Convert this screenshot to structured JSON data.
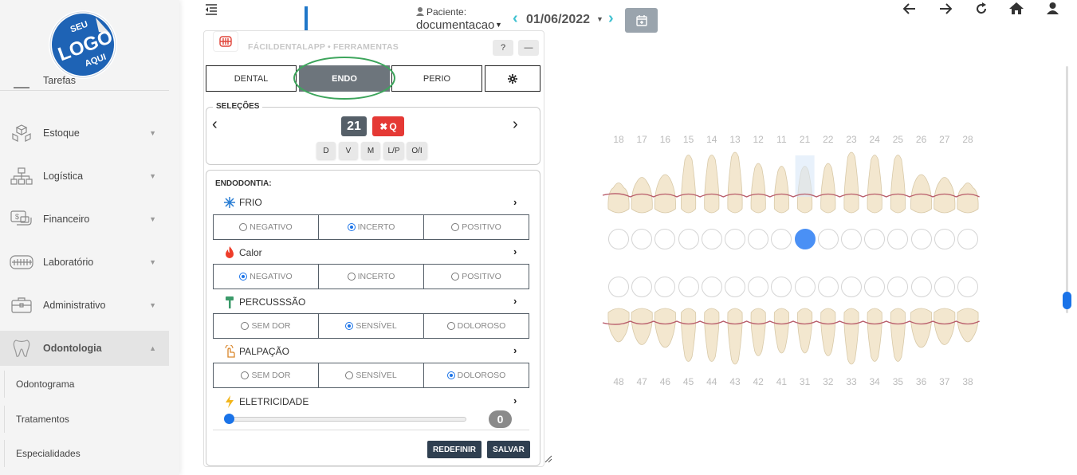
{
  "sidebar": {
    "logo": {
      "line1": "SEU",
      "line2": "LOGO",
      "line3": "AQUI"
    },
    "items": [
      {
        "label": "Tarefas",
        "icon": "tasks-icon"
      },
      {
        "label": "Estoque",
        "icon": "boxes-icon"
      },
      {
        "label": "Logística",
        "icon": "network-icon"
      },
      {
        "label": "Financeiro",
        "icon": "money-icon"
      },
      {
        "label": "Laboratório",
        "icon": "dental-lab-icon"
      },
      {
        "label": "Administrativo",
        "icon": "briefcase-icon"
      },
      {
        "label": "Odontologia",
        "icon": "tooth-icon"
      }
    ],
    "subitems": [
      "Odontograma",
      "Tratamentos",
      "Especialidades"
    ]
  },
  "topbar": {
    "patient_label": "Paciente:",
    "patient_name": "documentacao",
    "date": "01/06/2022"
  },
  "panel": {
    "title": "FÁCILDENTALAPP • FERRAMENTAS",
    "tabs": [
      "DENTAL",
      "ENDO",
      "PERIO"
    ],
    "active_tab": "ENDO",
    "selections": {
      "legend": "SELEÇÕES",
      "tooth": "21",
      "remove": "Q",
      "faces": [
        "D",
        "V",
        "M",
        "L/P",
        "O/I"
      ]
    },
    "endo": {
      "legend": "ENDODONTIA:",
      "rows": [
        {
          "label": "FRIO",
          "icon": "snowflake-icon",
          "options": [
            "NEGATIVO",
            "INCERTO",
            "POSITIVO"
          ],
          "selected": 1
        },
        {
          "label": "Calor",
          "icon": "fire-icon",
          "options": [
            "NEGATIVO",
            "INCERTO",
            "POSITIVO"
          ],
          "selected": 0
        },
        {
          "label": "PERCUSSSÃO",
          "icon": "hammer-icon",
          "options": [
            "SEM DOR",
            "SENSÍVEL",
            "DOLOROSO"
          ],
          "selected": 1
        },
        {
          "label": "PALPAÇÃO",
          "icon": "finger-icon",
          "options": [
            "SEM DOR",
            "SENSÍVEL",
            "DOLOROSO"
          ],
          "selected": 2
        }
      ],
      "electricity": {
        "label": "ELETRICIDADE",
        "value": "0"
      }
    },
    "buttons": {
      "reset": "REDEFINIR",
      "save": "SALVAR"
    }
  },
  "odontogram": {
    "upper": [
      "18",
      "17",
      "16",
      "15",
      "14",
      "13",
      "12",
      "11",
      "21",
      "22",
      "23",
      "24",
      "25",
      "26",
      "27",
      "28"
    ],
    "lower": [
      "48",
      "47",
      "46",
      "45",
      "44",
      "43",
      "42",
      "41",
      "31",
      "32",
      "33",
      "34",
      "35",
      "36",
      "37",
      "38"
    ],
    "selected_tooth": "21",
    "colors": {
      "gum_line": "#b85c6a",
      "selected": "#4a90f5"
    }
  }
}
